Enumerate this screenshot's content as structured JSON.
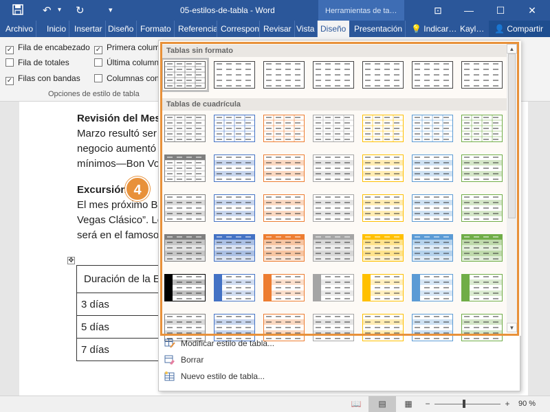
{
  "app": {
    "title": "05-estilos-de-tabla  -  Word",
    "contextual_tab": "Herramientas de ta…",
    "account": "Kayl…",
    "share_label": "Compartir",
    "tellme_label": "Indicar…",
    "brand_color": "#2b579a",
    "accent_color": "#e8913a"
  },
  "quick_access": {
    "save_icon": "save-icon",
    "undo_icon": "undo-icon",
    "redo_icon": "redo-icon",
    "customize_icon": "customize-icon"
  },
  "window_controls": {
    "ribbon_display_icon": "ribbon-display-icon",
    "minimize_icon": "minimize-icon",
    "maximize_icon": "maximize-icon",
    "close_icon": "close-icon"
  },
  "ribbon_tabs": [
    "Archivo",
    "Inicio",
    "Insertar",
    "Diseño",
    "Formato",
    "Referencia",
    "Correspon",
    "Revisar",
    "Vista",
    "Diseño",
    "Presentación"
  ],
  "ribbon": {
    "style_options": [
      {
        "label": "Fila de encabezado",
        "checked": true
      },
      {
        "label": "Fila de totales",
        "checked": false
      },
      {
        "label": "Filas con bandas",
        "checked": true
      },
      {
        "label": "Primera column",
        "checked": true
      },
      {
        "label": "Última column",
        "checked": false
      },
      {
        "label": "Columnas con",
        "checked": false
      }
    ],
    "group_label": "Opciones de estilo de tabla"
  },
  "document": {
    "para1_heading": "Revisión del Mes",
    "para1_lines": [
      "Marzo resultó ser",
      "negocio aumentó",
      "mínimos—Bon Vo"
    ],
    "para2_heading": "Excursión",
    "para2_lines": [
      "El mes próximo B",
      "Vegas Clásico”. Lo",
      "será en el famoso"
    ],
    "table_rows": [
      "Duración de la E",
      "3 días",
      "5 días",
      "7 días"
    ]
  },
  "callout_number": "4",
  "gallery": {
    "section1": "Tablas sin formato",
    "section2": "Tablas de cuadrícula",
    "palette": [
      "#7f7f7f",
      "#4472c4",
      "#ed7d31",
      "#a5a5a5",
      "#ffc000",
      "#5b9bd5",
      "#70ad47"
    ],
    "plain_styles": 7,
    "grid_rows": 6,
    "selected_style": "Tabla normal",
    "menu": [
      {
        "label": "Modificar estilo de tabla...",
        "icon": "modify-table-style-icon"
      },
      {
        "label": "Borrar",
        "icon": "eraser-icon"
      },
      {
        "label": "Nuevo estilo de tabla...",
        "icon": "new-table-style-icon"
      }
    ]
  },
  "status": {
    "zoom": "90 %",
    "zoom_fraction": 0.45
  }
}
